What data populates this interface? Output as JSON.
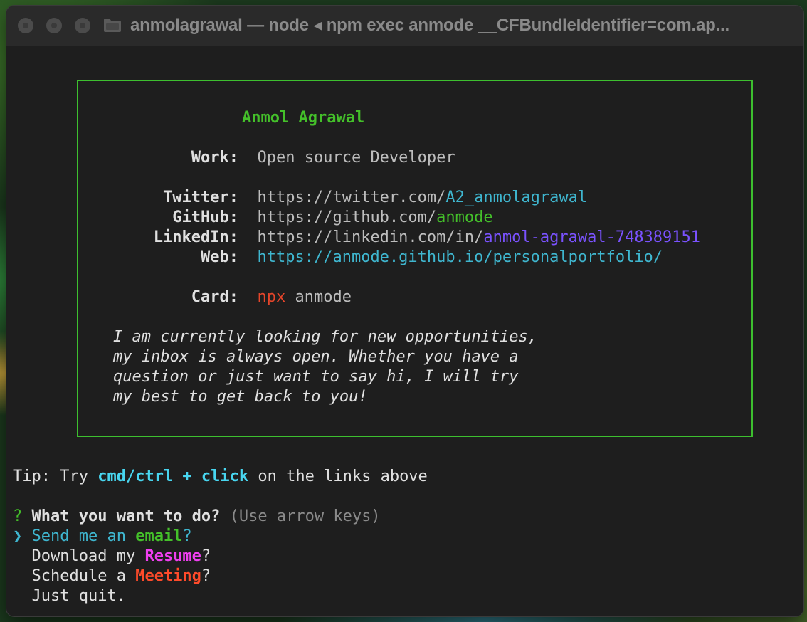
{
  "window": {
    "title": "anmolagrawal — node ◂ npm exec anmode __CFBundleIdentifier=com.ap..."
  },
  "card": {
    "name": "Anmol Agrawal",
    "work_label": "Work:",
    "work_value": "Open source Developer",
    "twitter_label": "Twitter:",
    "twitter_prefix": "https://twitter.com/",
    "twitter_handle": "A2_anmolagrawal",
    "github_label": "GitHub:",
    "github_prefix": "https://github.com/",
    "github_handle": "anmode",
    "linkedin_label": "LinkedIn:",
    "linkedin_prefix": "https://linkedin.com/in/",
    "linkedin_handle": "anmol-agrawal-748389151",
    "web_label": "Web:",
    "web_url": "https://anmode.github.io/personalportfolio/",
    "card_label": "Card:",
    "card_cmd": "npx",
    "card_pkg": "anmode",
    "bio": [
      "I am currently looking for new opportunities,",
      "my inbox is always open. Whether you have a",
      "question or just want to say hi, I will try",
      "my best to get back to you!"
    ]
  },
  "tip": {
    "prefix": "Tip: Try ",
    "shortcut": "cmd/ctrl + click",
    "suffix": " on the links above"
  },
  "prompt": {
    "marker": "?",
    "question": "What you want to do?",
    "hint": "(Use arrow keys)",
    "pointer": "❯",
    "options": [
      {
        "before": "Send me an ",
        "highlight": "email",
        "after": "?"
      },
      {
        "before": "Download my ",
        "highlight": "Resume",
        "after": "?"
      },
      {
        "before": "Schedule a ",
        "highlight": "Meeting",
        "after": "?"
      },
      {
        "before": "Just quit.",
        "highlight": "",
        "after": ""
      }
    ]
  },
  "colors": {
    "border": "#3dbf2f",
    "name": "#44c02a",
    "twitter": "#3fb6cf",
    "github": "#44c02a",
    "linkedin": "#7a52ff",
    "web": "#3fb6cf",
    "npx": "#e5452a",
    "tip_highlight": "#48d6f0",
    "email": "#44c02a",
    "resume": "#f03ff0",
    "meeting": "#ff4b2a"
  }
}
